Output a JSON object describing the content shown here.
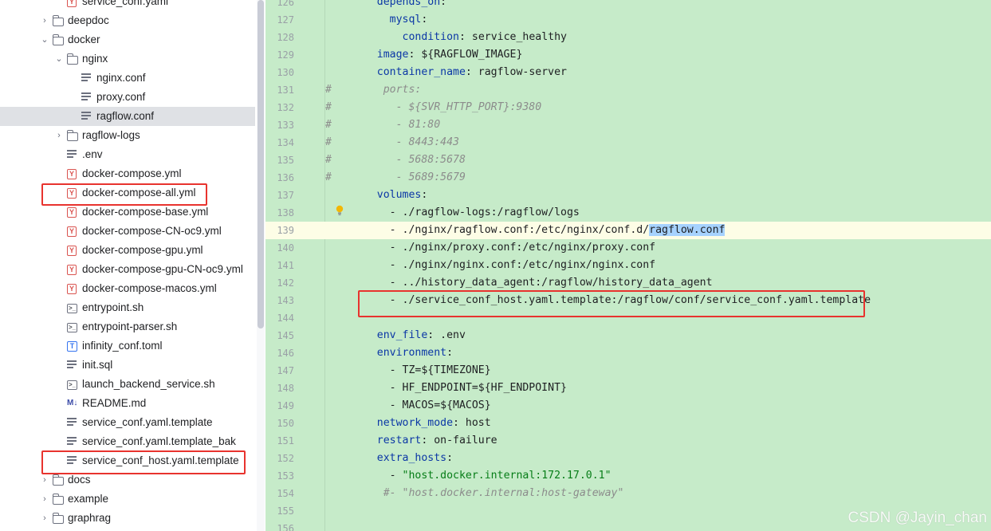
{
  "tree": {
    "items": [
      {
        "label": "service_conf.yaml",
        "icon": "yaml-file-icon",
        "indent": 2,
        "chev": ""
      },
      {
        "label": "deepdoc",
        "icon": "folder-icon",
        "indent": 1,
        "chev": "›"
      },
      {
        "label": "docker",
        "icon": "folder-icon",
        "indent": 1,
        "chev": "⌄"
      },
      {
        "label": "nginx",
        "icon": "folder-icon",
        "indent": 2,
        "chev": "⌄"
      },
      {
        "label": "nginx.conf",
        "icon": "text-file-icon",
        "indent": 3,
        "chev": ""
      },
      {
        "label": "proxy.conf",
        "icon": "text-file-icon",
        "indent": 3,
        "chev": ""
      },
      {
        "label": "ragflow.conf",
        "icon": "text-file-icon",
        "indent": 3,
        "chev": "",
        "selected": true
      },
      {
        "label": "ragflow-logs",
        "icon": "folder-icon",
        "indent": 2,
        "chev": "›"
      },
      {
        "label": ".env",
        "icon": "text-file-icon",
        "indent": 2,
        "chev": ""
      },
      {
        "label": "docker-compose.yml",
        "icon": "yaml-file-icon",
        "indent": 2,
        "chev": ""
      },
      {
        "label": "docker-compose-all.yml",
        "icon": "yaml-file-icon",
        "indent": 2,
        "chev": ""
      },
      {
        "label": "docker-compose-base.yml",
        "icon": "yaml-file-icon",
        "indent": 2,
        "chev": ""
      },
      {
        "label": "docker-compose-CN-oc9.yml",
        "icon": "yaml-file-icon",
        "indent": 2,
        "chev": ""
      },
      {
        "label": "docker-compose-gpu.yml",
        "icon": "yaml-file-icon",
        "indent": 2,
        "chev": ""
      },
      {
        "label": "docker-compose-gpu-CN-oc9.yml",
        "icon": "yaml-file-icon",
        "indent": 2,
        "chev": ""
      },
      {
        "label": "docker-compose-macos.yml",
        "icon": "yaml-file-icon",
        "indent": 2,
        "chev": ""
      },
      {
        "label": "entrypoint.sh",
        "icon": "shell-file-icon",
        "indent": 2,
        "chev": ""
      },
      {
        "label": "entrypoint-parser.sh",
        "icon": "shell-file-icon",
        "indent": 2,
        "chev": ""
      },
      {
        "label": "infinity_conf.toml",
        "icon": "toml-file-icon",
        "indent": 2,
        "chev": ""
      },
      {
        "label": "init.sql",
        "icon": "text-file-icon",
        "indent": 2,
        "chev": ""
      },
      {
        "label": "launch_backend_service.sh",
        "icon": "shell-file-icon",
        "indent": 2,
        "chev": ""
      },
      {
        "label": "README.md",
        "icon": "markdown-file-icon",
        "indent": 2,
        "chev": ""
      },
      {
        "label": "service_conf.yaml.template",
        "icon": "text-file-icon",
        "indent": 2,
        "chev": ""
      },
      {
        "label": "service_conf.yaml.template_bak",
        "icon": "text-file-icon",
        "indent": 2,
        "chev": ""
      },
      {
        "label": "service_conf_host.yaml.template",
        "icon": "text-file-icon",
        "indent": 2,
        "chev": ""
      },
      {
        "label": "docs",
        "icon": "folder-icon",
        "indent": 1,
        "chev": "›"
      },
      {
        "label": "example",
        "icon": "folder-icon",
        "indent": 1,
        "chev": "›"
      },
      {
        "label": "graphrag",
        "icon": "folder-icon",
        "indent": 1,
        "chev": "›"
      }
    ]
  },
  "editor": {
    "current_line": "139",
    "lines": [
      {
        "n": "126",
        "hash": "",
        "parts": [
          [
            "    ",
            ""
          ],
          [
            "depends_on",
            "k"
          ],
          [
            ":",
            ""
          ]
        ]
      },
      {
        "n": "127",
        "hash": "",
        "parts": [
          [
            "      ",
            ""
          ],
          [
            "mysql",
            "k"
          ],
          [
            ":",
            ""
          ]
        ]
      },
      {
        "n": "128",
        "hash": "",
        "parts": [
          [
            "        ",
            ""
          ],
          [
            "condition",
            "k"
          ],
          [
            ": service_healthy",
            ""
          ]
        ]
      },
      {
        "n": "129",
        "hash": "",
        "parts": [
          [
            "    ",
            ""
          ],
          [
            "image",
            "k"
          ],
          [
            ": ${RAGFLOW_IMAGE}",
            ""
          ]
        ]
      },
      {
        "n": "130",
        "hash": "",
        "parts": [
          [
            "    ",
            ""
          ],
          [
            "container_name",
            "k"
          ],
          [
            ": ragflow-server",
            ""
          ]
        ]
      },
      {
        "n": "131",
        "hash": "#",
        "parts": [
          [
            "     ports:",
            "c"
          ]
        ]
      },
      {
        "n": "132",
        "hash": "#",
        "parts": [
          [
            "       - ${SVR_HTTP_PORT}:9380",
            "c"
          ]
        ]
      },
      {
        "n": "133",
        "hash": "#",
        "parts": [
          [
            "       - 81:80",
            "c"
          ]
        ]
      },
      {
        "n": "134",
        "hash": "#",
        "parts": [
          [
            "       - 8443:443",
            "c"
          ]
        ]
      },
      {
        "n": "135",
        "hash": "#",
        "parts": [
          [
            "       - 5688:5678",
            "c"
          ]
        ]
      },
      {
        "n": "136",
        "hash": "#",
        "parts": [
          [
            "       - 5689:5679",
            "c"
          ]
        ]
      },
      {
        "n": "137",
        "hash": "",
        "parts": [
          [
            "    ",
            ""
          ],
          [
            "volumes",
            "k"
          ],
          [
            ":",
            ""
          ]
        ]
      },
      {
        "n": "138",
        "hash": "",
        "parts": [
          [
            "      - ./ragflow-logs:/ragflow/logs",
            ""
          ]
        ]
      },
      {
        "n": "139",
        "hash": "",
        "parts": [
          [
            "      - ./nginx/ragflow.conf:/etc/nginx/conf.d/",
            ""
          ],
          [
            "ragflow.conf",
            "hl"
          ]
        ]
      },
      {
        "n": "140",
        "hash": "",
        "parts": [
          [
            "      - ./nginx/proxy.conf:/etc/nginx/proxy.conf",
            ""
          ]
        ]
      },
      {
        "n": "141",
        "hash": "",
        "parts": [
          [
            "      - ./nginx/nginx.conf:/etc/nginx/nginx.conf",
            ""
          ]
        ]
      },
      {
        "n": "142",
        "hash": "",
        "parts": [
          [
            "      - ../history_data_agent:/ragflow/history_data_agent",
            ""
          ]
        ]
      },
      {
        "n": "143",
        "hash": "",
        "parts": [
          [
            "      - ./service_conf_host.yaml.template:/ragflow/conf/service_conf.yaml.template",
            ""
          ]
        ]
      },
      {
        "n": "144",
        "hash": "",
        "parts": []
      },
      {
        "n": "145",
        "hash": "",
        "parts": [
          [
            "    ",
            ""
          ],
          [
            "env_file",
            "k"
          ],
          [
            ": .env",
            ""
          ]
        ]
      },
      {
        "n": "146",
        "hash": "",
        "parts": [
          [
            "    ",
            ""
          ],
          [
            "environment",
            "k"
          ],
          [
            ":",
            ""
          ]
        ]
      },
      {
        "n": "147",
        "hash": "",
        "parts": [
          [
            "      - TZ=${TIMEZONE}",
            ""
          ]
        ]
      },
      {
        "n": "148",
        "hash": "",
        "parts": [
          [
            "      - HF_ENDPOINT=${HF_ENDPOINT}",
            ""
          ]
        ]
      },
      {
        "n": "149",
        "hash": "",
        "parts": [
          [
            "      - MACOS=${MACOS}",
            ""
          ]
        ]
      },
      {
        "n": "150",
        "hash": "",
        "parts": [
          [
            "    ",
            ""
          ],
          [
            "network_mode",
            "k"
          ],
          [
            ": host",
            ""
          ]
        ]
      },
      {
        "n": "151",
        "hash": "",
        "parts": [
          [
            "    ",
            ""
          ],
          [
            "restart",
            "k"
          ],
          [
            ": on-failure",
            ""
          ]
        ]
      },
      {
        "n": "152",
        "hash": "",
        "parts": [
          [
            "    ",
            ""
          ],
          [
            "extra_hosts",
            "k"
          ],
          [
            ":",
            ""
          ]
        ]
      },
      {
        "n": "153",
        "hash": "",
        "parts": [
          [
            "      - ",
            ""
          ],
          [
            "\"host.docker.internal:172.17.0.1\"",
            "s"
          ]
        ]
      },
      {
        "n": "154",
        "hash": "",
        "parts": [
          [
            "     #- \"host.docker.internal:host-gateway\"",
            "c"
          ]
        ]
      },
      {
        "n": "155",
        "hash": "",
        "parts": []
      },
      {
        "n": "156",
        "hash": "",
        "parts": []
      }
    ]
  },
  "watermark": "CSDN @Jayin_chan",
  "colors": {
    "highlight_box": "#e8332e",
    "editor_bg": "#c6ebc9",
    "keyword": "#0b37a6",
    "comment": "#8c8c8c",
    "string": "#067d17"
  }
}
